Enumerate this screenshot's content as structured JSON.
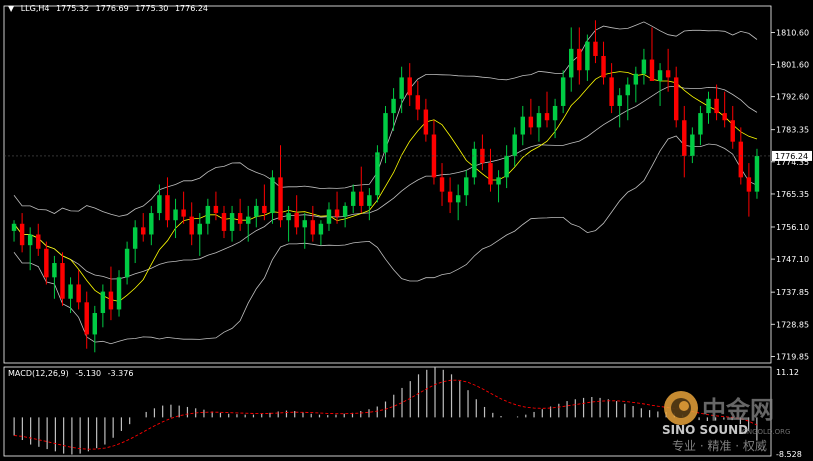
{
  "symbol_header": {
    "symbol": "LLG,H4",
    "open": "1775.32",
    "high": "1776.69",
    "low": "1775.30",
    "close": "1776.24"
  },
  "current_price_label": "1776.24",
  "macd_header": {
    "name": "MACD(12,26,9)",
    "macd": "-5.130",
    "signal": "-3.376"
  },
  "watermark": {
    "cn_name": "中金网",
    "en_name": "SINO SOUND",
    "url": "CNGOLD.ORG",
    "motto": "专业 · 精准 · 权威"
  },
  "colors": {
    "background": "#000000",
    "up_candle": "#00cc44",
    "down_candle": "#ff0000",
    "bollinger": "#c0c0c0",
    "ma": "#ffff00",
    "macd_hist": "#c0c0c0",
    "macd_signal": "#ff0000",
    "axis": "#ffffff",
    "price_tag_bg": "#ffffff"
  },
  "chart_data": {
    "type": "candlestick",
    "title": "LLG,H4",
    "price_axis": {
      "ticks": [
        1810.6,
        1801.6,
        1792.6,
        1783.35,
        1774.35,
        1765.35,
        1756.1,
        1747.1,
        1737.85,
        1728.85,
        1719.85
      ],
      "tick_labels": [
        "1810.60",
        "1801.60",
        "1792.60",
        "1783.35",
        "1774.35",
        "1765.35",
        "1756.10",
        "1747.10",
        "1737.85",
        "1728.85",
        "1719.85"
      ],
      "range": [
        1718,
        1818
      ]
    },
    "macd_axis": {
      "tick_labels": [
        "11.12",
        "-8.528"
      ],
      "range": [
        -8.528,
        11.12
      ]
    },
    "candles": [
      [
        1755,
        1758,
        1752,
        1757
      ],
      [
        1757,
        1760,
        1749,
        1751
      ],
      [
        1751,
        1756,
        1744,
        1754
      ],
      [
        1754,
        1757,
        1748,
        1750
      ],
      [
        1750,
        1752,
        1740,
        1742
      ],
      [
        1742,
        1748,
        1736,
        1746
      ],
      [
        1746,
        1749,
        1734,
        1736
      ],
      [
        1736,
        1742,
        1732,
        1740
      ],
      [
        1740,
        1744,
        1733,
        1735
      ],
      [
        1735,
        1738,
        1722,
        1726
      ],
      [
        1726,
        1734,
        1721,
        1732
      ],
      [
        1732,
        1740,
        1728,
        1738
      ],
      [
        1738,
        1745,
        1730,
        1733
      ],
      [
        1733,
        1744,
        1731,
        1742
      ],
      [
        1742,
        1752,
        1740,
        1750
      ],
      [
        1750,
        1758,
        1746,
        1756
      ],
      [
        1756,
        1760,
        1752,
        1754
      ],
      [
        1754,
        1762,
        1751,
        1760
      ],
      [
        1760,
        1768,
        1758,
        1765
      ],
      [
        1765,
        1770,
        1756,
        1758
      ],
      [
        1758,
        1764,
        1753,
        1761
      ],
      [
        1761,
        1766,
        1757,
        1759
      ],
      [
        1759,
        1763,
        1751,
        1754
      ],
      [
        1754,
        1760,
        1748,
        1757
      ],
      [
        1757,
        1764,
        1754,
        1762
      ],
      [
        1762,
        1766,
        1758,
        1760
      ],
      [
        1760,
        1762,
        1753,
        1755
      ],
      [
        1755,
        1762,
        1752,
        1760
      ],
      [
        1760,
        1764,
        1755,
        1757
      ],
      [
        1757,
        1762,
        1752,
        1759
      ],
      [
        1759,
        1764,
        1756,
        1762
      ],
      [
        1762,
        1768,
        1758,
        1760
      ],
      [
        1760,
        1772,
        1757,
        1770
      ],
      [
        1770,
        1779,
        1756,
        1758
      ],
      [
        1758,
        1762,
        1752,
        1760
      ],
      [
        1760,
        1765,
        1754,
        1756
      ],
      [
        1756,
        1760,
        1750,
        1758
      ],
      [
        1758,
        1762,
        1752,
        1754
      ],
      [
        1754,
        1758,
        1751,
        1757
      ],
      [
        1757,
        1763,
        1755,
        1761
      ],
      [
        1761,
        1766,
        1757,
        1759
      ],
      [
        1759,
        1763,
        1756,
        1762
      ],
      [
        1762,
        1768,
        1760,
        1766
      ],
      [
        1766,
        1773,
        1760,
        1762
      ],
      [
        1762,
        1767,
        1758,
        1765
      ],
      [
        1765,
        1779,
        1763,
        1777
      ],
      [
        1777,
        1790,
        1774,
        1788
      ],
      [
        1788,
        1795,
        1783,
        1792
      ],
      [
        1792,
        1801,
        1788,
        1798
      ],
      [
        1798,
        1802,
        1790,
        1793
      ],
      [
        1793,
        1797,
        1786,
        1789
      ],
      [
        1789,
        1792,
        1780,
        1782
      ],
      [
        1782,
        1786,
        1768,
        1770
      ],
      [
        1770,
        1774,
        1762,
        1766
      ],
      [
        1766,
        1770,
        1760,
        1763
      ],
      [
        1763,
        1768,
        1758,
        1765
      ],
      [
        1765,
        1772,
        1762,
        1770
      ],
      [
        1770,
        1780,
        1768,
        1778
      ],
      [
        1778,
        1782,
        1772,
        1774
      ],
      [
        1774,
        1778,
        1766,
        1768
      ],
      [
        1768,
        1772,
        1763,
        1770
      ],
      [
        1770,
        1779,
        1767,
        1776
      ],
      [
        1776,
        1784,
        1773,
        1782
      ],
      [
        1782,
        1790,
        1779,
        1787
      ],
      [
        1787,
        1792,
        1782,
        1784
      ],
      [
        1784,
        1790,
        1780,
        1788
      ],
      [
        1788,
        1794,
        1784,
        1786
      ],
      [
        1786,
        1792,
        1781,
        1790
      ],
      [
        1790,
        1800,
        1788,
        1798
      ],
      [
        1798,
        1812,
        1794,
        1806
      ],
      [
        1806,
        1812,
        1796,
        1800
      ],
      [
        1800,
        1810,
        1797,
        1808
      ],
      [
        1808,
        1814,
        1802,
        1804
      ],
      [
        1804,
        1808,
        1796,
        1798
      ],
      [
        1798,
        1802,
        1788,
        1790
      ],
      [
        1790,
        1795,
        1784,
        1793
      ],
      [
        1793,
        1798,
        1786,
        1796
      ],
      [
        1796,
        1801,
        1791,
        1799
      ],
      [
        1799,
        1806,
        1796,
        1803
      ],
      [
        1803,
        1812,
        1799,
        1797
      ],
      [
        1797,
        1802,
        1790,
        1800
      ],
      [
        1800,
        1806,
        1794,
        1798
      ],
      [
        1798,
        1801,
        1784,
        1786
      ],
      [
        1786,
        1790,
        1770,
        1776
      ],
      [
        1776,
        1784,
        1774,
        1782
      ],
      [
        1782,
        1790,
        1779,
        1788
      ],
      [
        1788,
        1794,
        1785,
        1792
      ],
      [
        1792,
        1796,
        1786,
        1788
      ],
      [
        1788,
        1794,
        1784,
        1786
      ],
      [
        1786,
        1790,
        1778,
        1780
      ],
      [
        1780,
        1784,
        1768,
        1770
      ],
      [
        1770,
        1774,
        1759,
        1766
      ],
      [
        1766,
        1778,
        1764,
        1776
      ]
    ],
    "macd_histogram": [
      -4,
      -5,
      -6,
      -6.5,
      -7,
      -7.5,
      -8,
      -8.2,
      -8,
      -7.5,
      -6.8,
      -6,
      -4.5,
      -3,
      -1.5,
      0,
      1.2,
      2,
      2.6,
      2.8,
      2.6,
      2.3,
      2,
      1.7,
      1.3,
      1,
      0.8,
      0.7,
      0.6,
      0.6,
      0.8,
      1,
      1.3,
      1.5,
      1.4,
      1.1,
      0.8,
      0.6,
      0.5,
      0.6,
      0.8,
      1,
      1.4,
      1.8,
      2.4,
      3.5,
      5,
      6.5,
      8,
      9.5,
      10.5,
      11,
      10.5,
      9.5,
      8,
      6,
      4,
      2.3,
      1,
      0.3,
      0,
      0.2,
      0.6,
      1.2,
      1.8,
      2.4,
      3,
      3.6,
      4,
      4.3,
      4.5,
      4.3,
      4,
      3.6,
      3,
      2.5,
      2,
      1.6,
      1.3,
      1.2,
      1,
      0.6,
      0,
      -0.6,
      -0.8,
      -0.7,
      -0.5,
      -0.6,
      -1.5,
      -3,
      -5.13
    ]
  }
}
